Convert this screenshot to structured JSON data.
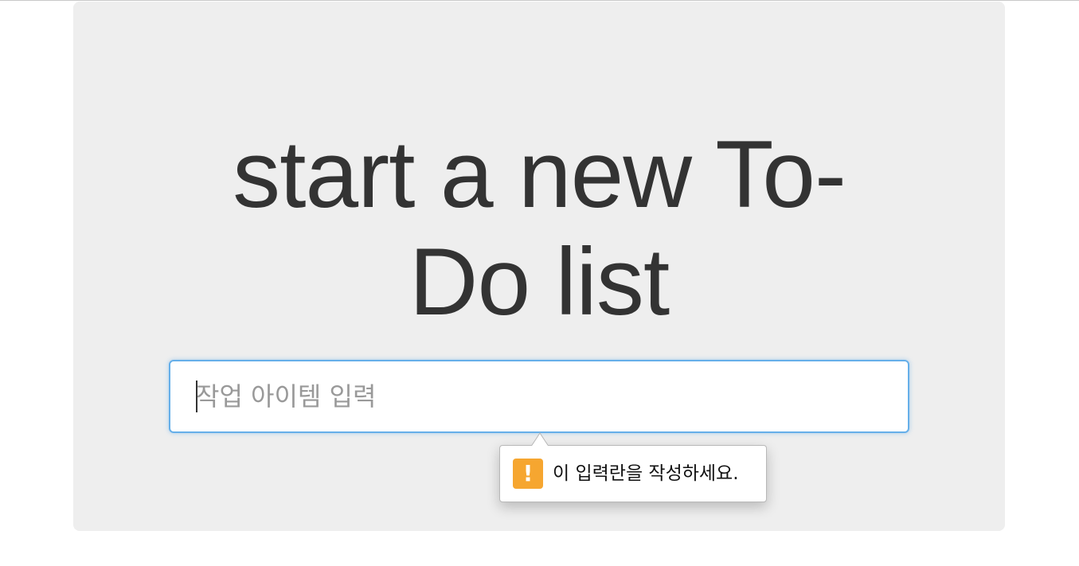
{
  "heading": {
    "line1": "start a new To-",
    "line2": "Do list"
  },
  "input": {
    "placeholder": "작업 아이템 입력",
    "value": ""
  },
  "validation_tooltip": {
    "icon": "warning-icon",
    "icon_glyph": "!",
    "message": "이 입력란을 작성하세요.",
    "icon_color": "#f6a630"
  },
  "colors": {
    "panel_background": "#eeeeee",
    "heading_text": "#333333",
    "input_focus_border": "#66afe9"
  }
}
